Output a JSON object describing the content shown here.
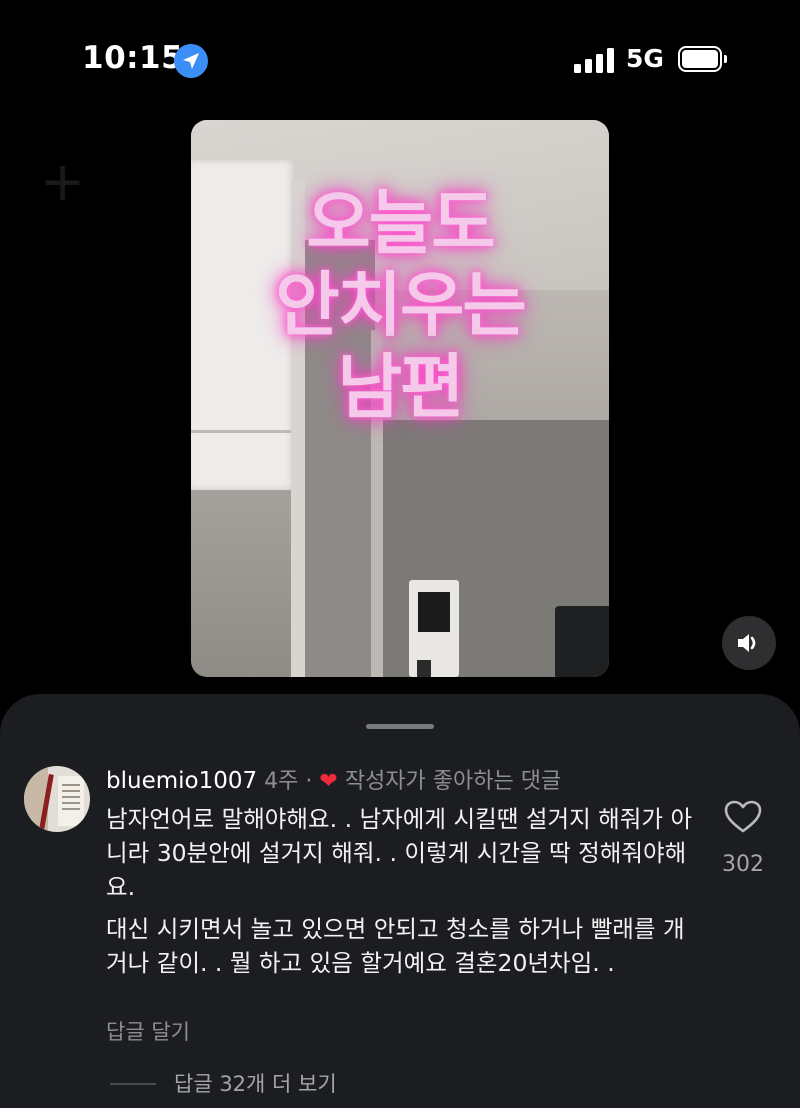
{
  "status_bar": {
    "time": "10:15",
    "network": "5G",
    "location_icon": "location-arrow-icon",
    "signal_icon": "cellular-signal-icon",
    "battery_icon": "battery-icon"
  },
  "video": {
    "overlay_lines": [
      "오늘도",
      "안치우는",
      "남편"
    ],
    "volume_icon": "speaker-volume-icon"
  },
  "comment": {
    "username": "bluemio1007",
    "age": "4주",
    "separator": "·",
    "creator_liked_label": "작성자가 좋아하는 댓글",
    "text_paragraph_1": "남자언어로 말해야해요. . 남자에게 시킬땐 설거지 해줘가 아니라 30분안에 설거지 해줘. . 이렇게 시간을 딱 정해줘야해요.",
    "text_paragraph_2": "대신 시키면서 놀고 있으면 안되고 청소를 하거나 빨래를 개거나 같이. . 뭘 하고 있음 할거예요  결혼20년차임. .",
    "reply_label": "답글 달기",
    "like_count": "302",
    "view_replies_label": "답글 32개 더 보기"
  },
  "colors": {
    "background": "#000000",
    "sheet": "#1c1d21",
    "overlay_text_glow": "#ff3cc8",
    "heart": "#ee2a3c",
    "location_blue": "#3a8ef6"
  }
}
